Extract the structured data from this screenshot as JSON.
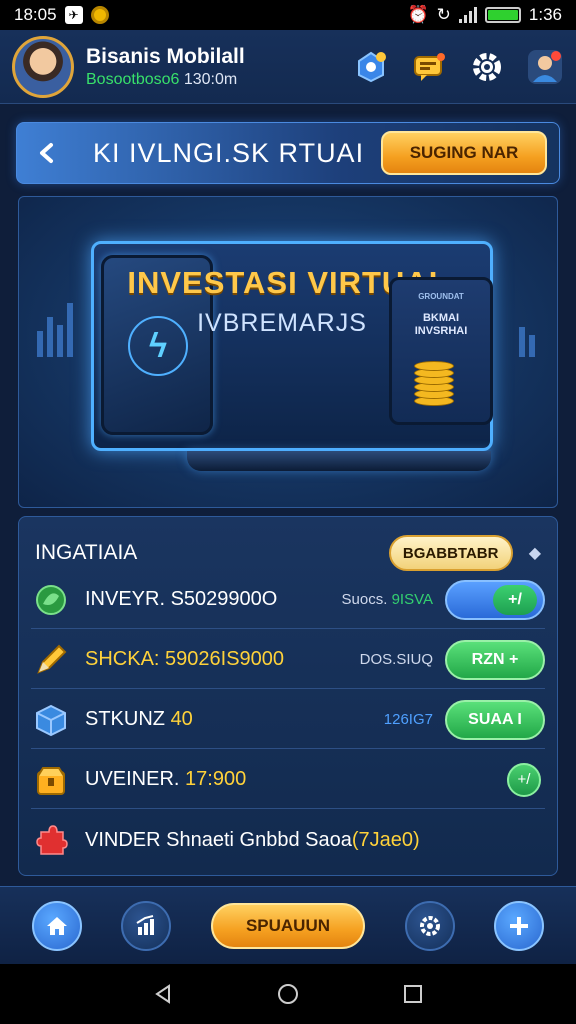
{
  "status_bar": {
    "time_left": "18:05",
    "time_right": "1:36"
  },
  "header": {
    "user_name": "Bisanis Mobilall",
    "user_sub_green": "Bosootboso6",
    "user_sub_white": "130:0m",
    "icons": [
      "notification-bell-icon",
      "chat-icon",
      "gear-icon",
      "profile-icon"
    ]
  },
  "title_bar": {
    "title": "KI IVLNGI.SK RTUAI",
    "cta_label": "SUGING NAR"
  },
  "banner": {
    "headline": "INVESTASI VIRTUAL",
    "subline": "IVBREMARJS",
    "phone_text": "BKMAI INVSRHAI",
    "phone_top": "GROUNDAT"
  },
  "panel": {
    "title": "INGATIAIA",
    "pill_label": "BGABBTABR",
    "rows": [
      {
        "label": "INVEYR. S5029900O",
        "value_prefix": "Suocs.",
        "value_green": "9ISVA",
        "button_label": "+/",
        "icon": "leaf-coin-icon"
      },
      {
        "label": "SHCKA: 59026IS9000",
        "value": "DOS.SIUQ",
        "button_label": "RZN +",
        "icon": "pencil-icon"
      },
      {
        "label_prefix": "STKUNZ",
        "label_highlight": "40",
        "value": "126IG7",
        "button_label": "SUAA I",
        "icon": "cube-icon"
      },
      {
        "label_prefix": "UVEINER.",
        "label_highlight": "17:900",
        "button_label": "+/",
        "icon": "chest-icon"
      },
      {
        "label_prefix": "VINDER Shnaeti Gnbbd Saoa",
        "label_highlight": "(7Jae0)",
        "icon": "puzzle-icon"
      }
    ]
  },
  "bottom_nav": {
    "cta_label": "SPUAUUN",
    "items": [
      "home-icon",
      "chart-icon",
      "settings-circle-icon",
      "plus-icon"
    ]
  }
}
